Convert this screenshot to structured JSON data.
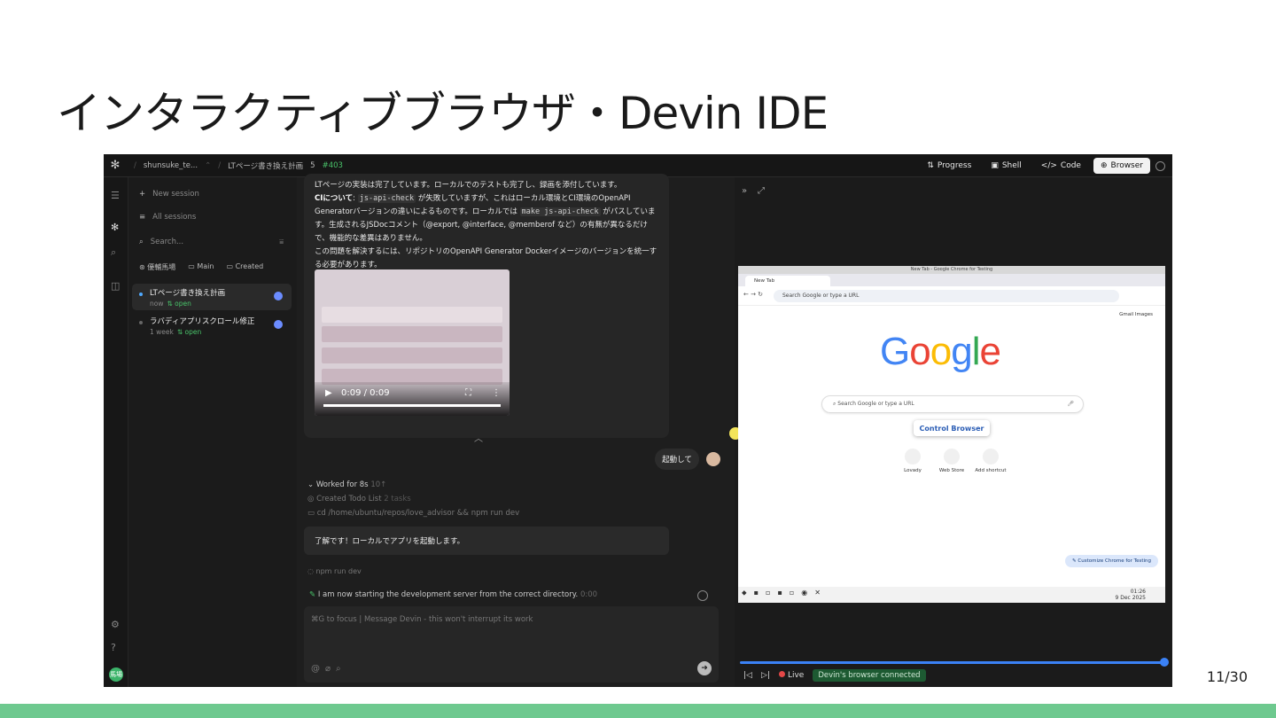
{
  "slide": {
    "title": "インタラクティブブラウザ・Devin IDE",
    "page": "11/30"
  },
  "topbar": {
    "user": "shunsuke_te...",
    "session_title": "LTページ書き換え計画",
    "count": "5",
    "pr": "#403",
    "tabs": [
      {
        "label": "Progress",
        "icon": "progress-icon"
      },
      {
        "label": "Shell",
        "icon": "terminal-icon"
      },
      {
        "label": "Code",
        "icon": "code-icon"
      },
      {
        "label": "Browser",
        "icon": "globe-icon"
      }
    ],
    "active_tab": "Browser"
  },
  "sidebar": {
    "new_session": "New session",
    "all_sessions": "All sessions",
    "search_placeholder": "Search...",
    "repo": "優輔馬場",
    "branch": "Main",
    "created": "Created",
    "sessions": [
      {
        "title": "LTページ書き換え計画",
        "time": "now",
        "status": "open"
      },
      {
        "title": "ラバディアプリスクロール修正",
        "time": "1 week",
        "status": "open"
      }
    ],
    "avatar_initials": "馬場"
  },
  "chat": {
    "p1": "LTページの実装は完了しています。ローカルでのテストも完了し、録画を添付しています。",
    "p2_label": "CIについて",
    "p2_a": ": ",
    "p2_code1": "js-api-check",
    "p2_b": " が失敗していますが、これはローカル環境とCI環境のOpenAPI Generatorバージョンの違いによるものです。ローカルでは ",
    "p2_code2": "make js-api-check",
    "p2_c": " がパスしています。生成されるJSDocコメント（@export, @interface, @memberof など）の有無が異なるだけで、機能的な差異はありません。",
    "p3": "この問題を解決するには、リポジトリのOpenAPI Generator Dockerイメージのバージョンを統一する必要があります。",
    "video_time": "0:09 / 0:09",
    "user_message": "起動して",
    "worked_label": "Worked for 8s",
    "worked_dim": "10↑",
    "step1": "Created Todo List",
    "step1_dim": "2 tasks",
    "step2": "cd /home/ubuntu/repos/love_advisor && npm run dev",
    "reply": "了解です！ローカルでアプリを起動します。",
    "npm": "npm run dev",
    "status": "I am now starting the development server from the correct directory.",
    "status_time": "0:00",
    "composer_placeholder": "⌘G to focus | Message Devin - this won't interrupt its work"
  },
  "browser": {
    "window_title": "New Tab - Google Chrome for Testing",
    "tab_label": "New Tab",
    "address_placeholder": "Search Google or type a URL",
    "links": "Gmail   Images",
    "logo": "Google",
    "search_placeholder": "Search Google or type a URL",
    "control_tip": "Control Browser",
    "shortcuts": [
      "Lovady",
      "Web Store",
      "Add shortcut"
    ],
    "customize": "Customize Chrome for Testing",
    "clock_time": "01:26",
    "clock_date": "9 Dec 2025",
    "live_label": "Live",
    "connected_label": "Devin's browser connected",
    "progress": 1.0
  },
  "colors": {
    "accent_green": "#49c46a",
    "slide_bar": "#6ec98f",
    "timeline_blue": "#3b82f6"
  }
}
